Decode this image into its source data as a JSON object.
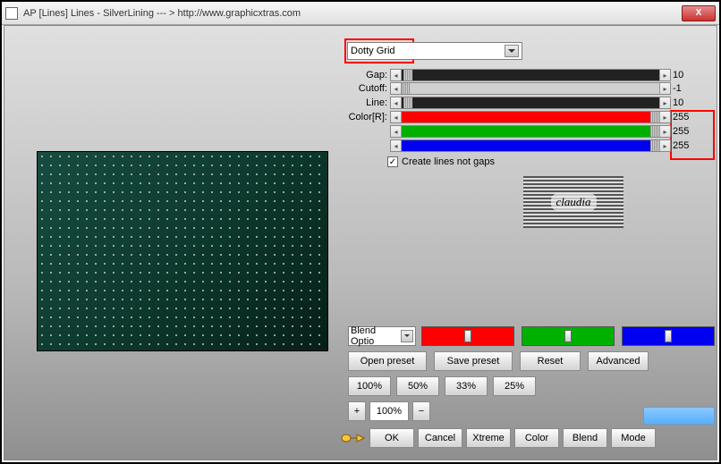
{
  "title": "AP [Lines]  Lines - SilverLining   --- >  http://www.graphicxtras.com",
  "close": "X",
  "preset": {
    "selected": "Dotty Grid"
  },
  "sliders": {
    "gap": {
      "label": "Gap:",
      "value": "10"
    },
    "cutoff": {
      "label": "Cutoff:",
      "value": "-1"
    },
    "line": {
      "label": "Line:",
      "value": "10"
    },
    "colorR": {
      "label": "Color[R]:",
      "value": "255"
    },
    "colorG": {
      "label": "",
      "value": "255"
    },
    "colorB": {
      "label": "",
      "value": "255"
    }
  },
  "checkbox": {
    "label": "Create lines not gaps",
    "checked": true
  },
  "logo_text": "claudia",
  "blend_option": "Blend Optio",
  "buttons": {
    "open": "Open preset",
    "save": "Save preset",
    "reset": "Reset",
    "advanced": "Advanced",
    "p100": "100%",
    "p50": "50%",
    "p33": "33%",
    "p25": "25%",
    "zplus": "+",
    "zminus": "−",
    "zoom": "100%",
    "ok": "OK",
    "cancel": "Cancel",
    "xtreme": "Xtreme",
    "color": "Color",
    "blend": "Blend",
    "mode": "Mode"
  }
}
